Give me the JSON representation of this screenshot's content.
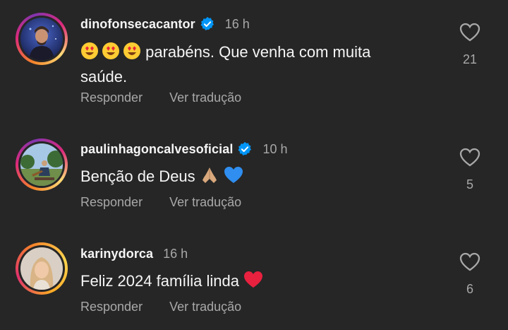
{
  "comments": [
    {
      "username": "dinofonsecacantor",
      "verified": true,
      "time": "16 h",
      "text_line1": "parabéns. Que venha com muita",
      "text_line2": "saúde.",
      "leading_emojis": [
        "smiling-face-with-heart-eyes",
        "smiling-face-with-heart-eyes",
        "smiling-face-with-heart-eyes"
      ],
      "likes": "21",
      "reply_label": "Responder",
      "translate_label": "Ver tradução"
    },
    {
      "username": "paulinhagoncalvesoficial",
      "verified": true,
      "time": "10 h",
      "text": "Benção de Deus",
      "trailing_emojis": [
        "folded-hands",
        "blue-heart"
      ],
      "likes": "5",
      "reply_label": "Responder",
      "translate_label": "Ver tradução"
    },
    {
      "username": "karinydorca",
      "verified": false,
      "time": "16 h",
      "text": "Feliz 2024 família linda",
      "trailing_emojis": [
        "red-heart"
      ],
      "likes": "6",
      "reply_label": "Responder",
      "translate_label": "Ver tradução"
    }
  ],
  "colors": {
    "background": "#262626",
    "primary_text": "#f5f5f5",
    "secondary_text": "#a8a8a8",
    "verified_blue": "#0095f6"
  }
}
